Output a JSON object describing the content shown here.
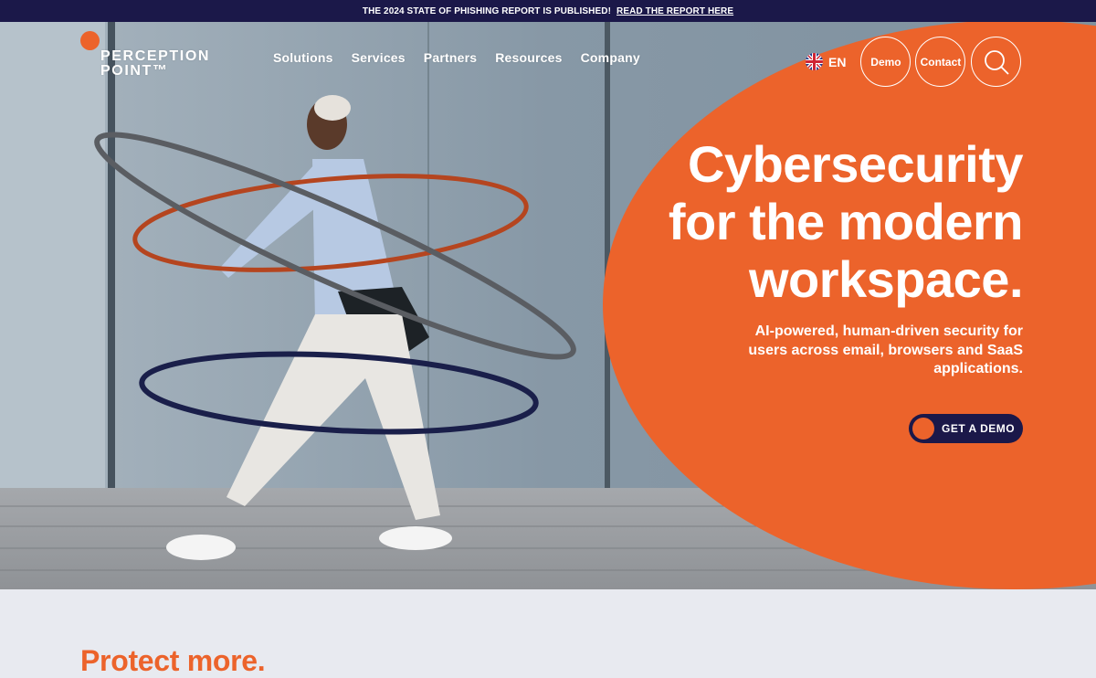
{
  "announcement": {
    "text": "THE 2024 STATE OF PHISHING REPORT IS PUBLISHED!",
    "link": "READ THE REPORT HERE"
  },
  "header": {
    "logo": {
      "line1": "PERCEPTION",
      "line2": "POINT™",
      "icon": "orange-dot"
    },
    "nav": [
      {
        "label": "Solutions"
      },
      {
        "label": "Services"
      },
      {
        "label": "Partners"
      },
      {
        "label": "Resources"
      },
      {
        "label": "Company"
      }
    ],
    "language": {
      "label": "EN",
      "icon": "uk-flag-icon"
    },
    "demo_label": "Demo",
    "contact_label": "Contact",
    "search_icon": "search-icon"
  },
  "hero": {
    "headline_line1": "Cybersecurity",
    "headline_line2": "for the modern",
    "headline_line3": "workspace.",
    "subhead": "AI-powered, human-driven security for users across email, browsers and SaaS applications.",
    "cta_label": "GET A DEMO",
    "image": "woman walking with three hoops (silver, orange, navy) in front of a grey wall"
  },
  "section": {
    "title": "Protect more."
  },
  "colors": {
    "brand_orange": "#ec632b",
    "brand_navy": "#1b1849",
    "page_bg": "#e8eaf0"
  }
}
